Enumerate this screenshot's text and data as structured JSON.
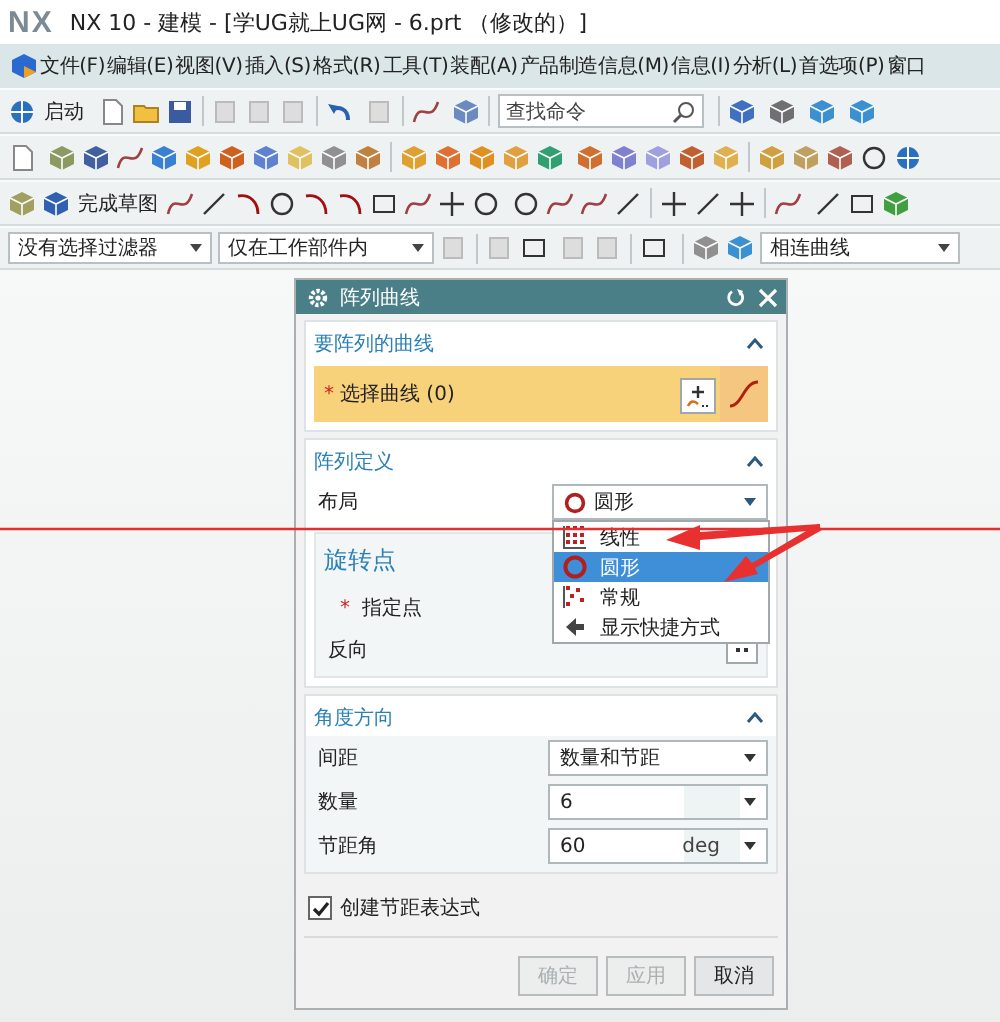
{
  "window": {
    "logo": "NX",
    "title": "NX 10 - 建模 - [学UG就上UG网 - 6.prt （修改的）]"
  },
  "menu_bar": [
    "文件(F)",
    "编辑(E)",
    "视图(V)",
    "插入(S)",
    "格式(R)",
    "工具(T)",
    "装配(A)",
    "产品制造信息(M)",
    "信息(I)",
    "分析(L)",
    "首选项(P)",
    "窗口"
  ],
  "toolbar": {
    "start_label": "启动",
    "search": {
      "placeholder": "查找命令"
    },
    "finish_sketch_label": "完成草图"
  },
  "selection_bar": {
    "filters": [
      "没有选择过滤器",
      "仅在工作部件内"
    ],
    "curve_rule": "相连曲线"
  },
  "dialog": {
    "title": "阵列曲线",
    "curves_section": {
      "title": "要阵列的曲线",
      "expanded": true,
      "required_mark": "*",
      "select_label": "选择曲线 (0)"
    },
    "definition_section": {
      "title": "阵列定义",
      "expanded": true,
      "layout_label": "布局",
      "layout_value": "圆形",
      "pivot": {
        "title": "旋转点",
        "point_required_mark": "*",
        "point_label": "指定点",
        "reverse_label": "反向"
      }
    },
    "angle_section": {
      "title": "角度方向",
      "expanded": true,
      "rows": [
        {
          "label": "间距",
          "kind": "select",
          "value": "数量和节距"
        },
        {
          "label": "数量",
          "kind": "input",
          "value": "6"
        },
        {
          "label": "节距角",
          "kind": "input",
          "value": "60",
          "unit": "deg"
        }
      ]
    },
    "checkbox": {
      "label": "创建节距表达式",
      "checked": true
    },
    "buttons": [
      {
        "label": "确定",
        "disabled": true
      },
      {
        "label": "应用",
        "disabled": true
      },
      {
        "label": "取消",
        "disabled": false
      }
    ]
  },
  "dropdown_menu": [
    {
      "label": "线性",
      "kind": "grid",
      "selected": false
    },
    {
      "label": "圆形",
      "kind": "circle",
      "selected": true
    },
    {
      "label": "常规",
      "kind": "scatter",
      "selected": false
    },
    {
      "label": "显示快捷方式",
      "kind": "shortcut",
      "selected": false
    }
  ]
}
